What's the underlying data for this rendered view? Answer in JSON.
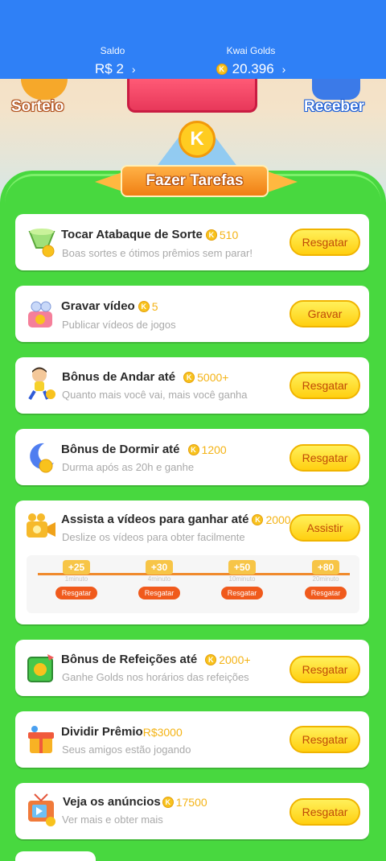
{
  "header": {
    "saldo_label": "Saldo",
    "saldo_value": "R$ 2",
    "golds_label": "Kwai Golds",
    "golds_value": "20.396"
  },
  "hero": {
    "sorteio_label": "Sorteio",
    "receber_label": "Receber",
    "banner_title": "Fazer Tarefas",
    "banner_coin": "K"
  },
  "tasks": [
    {
      "title": "Tocar Atabaque de Sorte",
      "reward": "510",
      "subtitle": "Boas sortes e ótimos prêmios sem parar!",
      "button": "Resgatar",
      "icon": "drum-icon"
    },
    {
      "title": "Gravar vídeo",
      "reward": "5",
      "subtitle": "Publicar vídeos de jogos",
      "button": "Gravar",
      "icon": "video-camera-icon"
    },
    {
      "title": "Bônus de Andar até",
      "reward": "5000+",
      "subtitle": "Quanto mais você vai, mais você ganha",
      "button": "Resgatar",
      "icon": "walking-boy-icon"
    },
    {
      "title": "Bônus de Dormir até",
      "reward": "1200",
      "subtitle": "Durma após as 20h e ganhe",
      "button": "Resgatar",
      "icon": "moon-sleep-icon"
    },
    {
      "title": "Assista a vídeos para ganhar até",
      "reward": "2000",
      "subtitle": "Deslize os vídeos para obter facilmente",
      "button": "Assistir",
      "icon": "movie-camera-icon",
      "steps": [
        {
          "amount": "+25",
          "time": "1minuto",
          "button": "Resgatar"
        },
        {
          "amount": "+30",
          "time": "4minuto",
          "button": "Resgatar"
        },
        {
          "amount": "+50",
          "time": "10minuto",
          "button": "Resgatar"
        },
        {
          "amount": "+80",
          "time": "20minuto",
          "button": "Resgatar"
        }
      ]
    },
    {
      "title": "Bônus de Refeições até",
      "reward": "2000+",
      "subtitle": "Ganhe Golds nos horários das refeições",
      "button": "Resgatar",
      "icon": "meal-box-icon"
    },
    {
      "title": "Dividir Prêmio",
      "reward": "R$3000",
      "subtitle": "Seus amigos estão jogando",
      "button": "Resgatar",
      "icon": "gift-box-icon"
    },
    {
      "title": "Veja os anúncios",
      "reward": "17500",
      "subtitle": "Ver mais e obter mais",
      "button": "Resgatar",
      "icon": "tv-icon"
    }
  ],
  "colors": {
    "header_blue": "#2f80f6",
    "panel_green": "#48d83f",
    "button_yellow": "#ffcf10",
    "reward_gold": "#f4b315"
  }
}
